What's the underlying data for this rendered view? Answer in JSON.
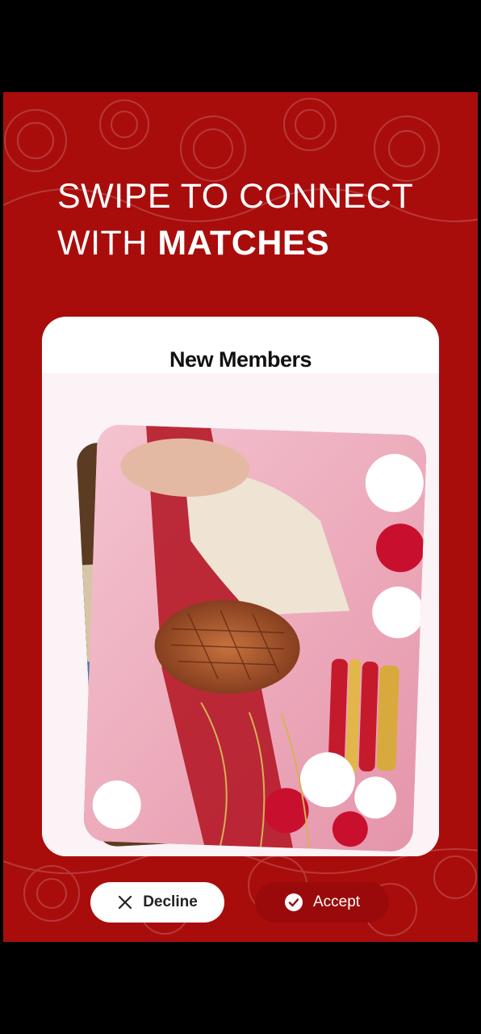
{
  "headline": {
    "line1": "SWIPE TO CONNECT",
    "line2_plain": "WITH ",
    "line2_bold": "MATCHES"
  },
  "card": {
    "title": "New Members",
    "photo_icon": "wedding-hands-photo"
  },
  "actions": {
    "decline_label": "Decline",
    "decline_icon": "close-icon",
    "accept_label": "Accept",
    "accept_icon": "check-circle-icon"
  },
  "colors": {
    "background": "#a80d0c",
    "card": "#ffffff",
    "accept_button": "#9b0a0a"
  }
}
